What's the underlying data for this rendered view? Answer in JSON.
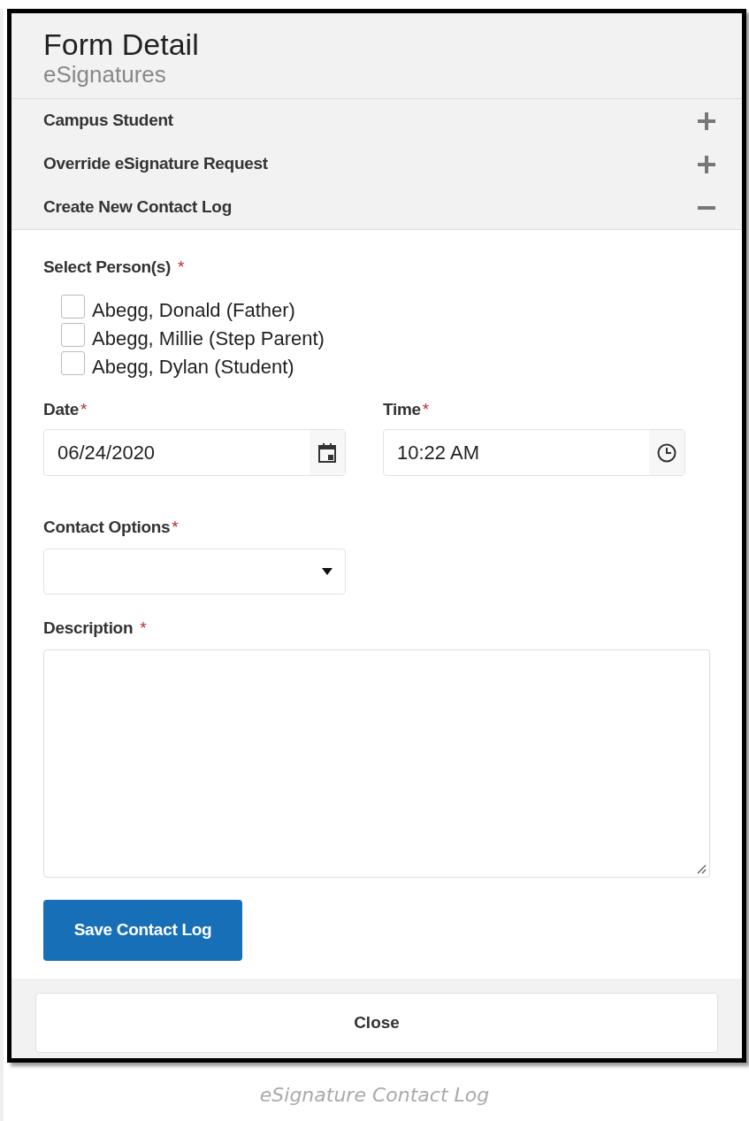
{
  "dialog": {
    "title": "Form Detail",
    "subtitle": "eSignatures"
  },
  "sections": [
    {
      "label": "Campus Student",
      "expanded": false
    },
    {
      "label": "Override eSignature Request",
      "expanded": false
    },
    {
      "label": "Create New Contact Log",
      "expanded": true
    }
  ],
  "persons": {
    "label": "Select Person(s)",
    "required_mark": "*",
    "options": [
      {
        "label": "Abegg, Donald (Father)",
        "checked": false
      },
      {
        "label": "Abegg, Millie (Step Parent)",
        "checked": false
      },
      {
        "label": "Abegg, Dylan (Student)",
        "checked": false
      }
    ]
  },
  "date": {
    "label": "Date",
    "required_mark": "*",
    "value": "06/24/2020"
  },
  "time": {
    "label": "Time",
    "required_mark": "*",
    "value": "10:22 AM"
  },
  "contact_options": {
    "label": "Contact Options",
    "required_mark": "*"
  },
  "description": {
    "label": "Description",
    "required_mark": "*"
  },
  "save_button": "Save Contact Log",
  "close_button": "Close",
  "caption": "eSignature Contact Log"
}
